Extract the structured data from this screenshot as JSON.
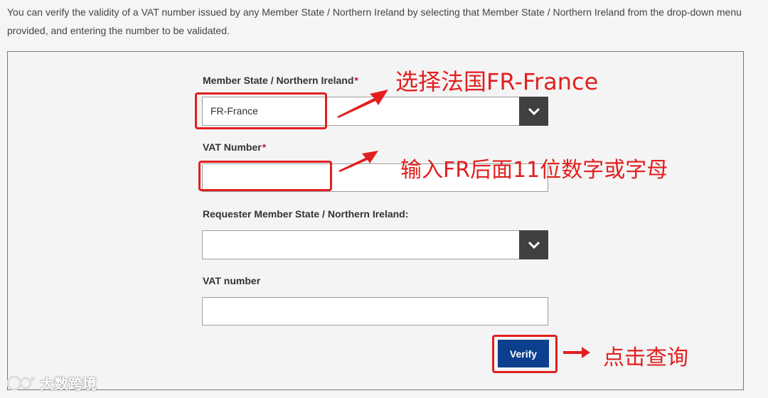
{
  "intro_text": "You can verify the validity of a VAT number issued by any Member State / Northern Ireland by selecting that Member State / Northern Ireland from the drop-down menu provided, and entering the number to be validated.",
  "form": {
    "member_state_label": "Member State / Northern Ireland",
    "member_state_value": "FR-France",
    "vat_number_label": "VAT Number",
    "vat_number_value": "",
    "requester_state_label": "Requester Member State / Northern Ireland:",
    "requester_state_value": "",
    "requester_vat_label": "VAT number",
    "requester_vat_value": "",
    "required_mark": "*",
    "verify_label": "Verify"
  },
  "annotations": {
    "select_france": "选择法国FR-France",
    "enter_vat": "输入FR后面11位数字或字母",
    "click_query": "点击查询",
    "color": "#e21f1f"
  },
  "watermark": {
    "text": "大数跨境"
  },
  "colors": {
    "primary_button": "#0d3f8f",
    "dropdown_button": "#404040",
    "required": "#c8102e"
  }
}
